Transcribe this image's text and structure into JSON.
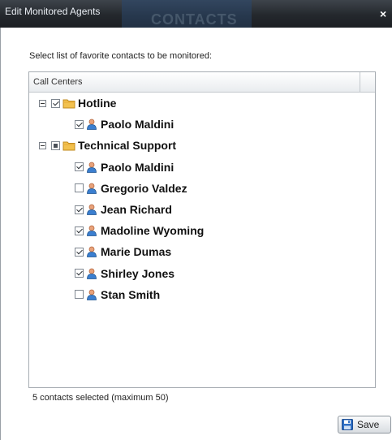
{
  "dialog": {
    "title": "Edit Monitored Agents",
    "background_tab_text": "CONTACTS",
    "close_label": "×",
    "instruction": "Select list of favorite contacts to be monitored:",
    "column_header": "Call Centers",
    "status": "5 contacts selected (maximum 50)",
    "save_label": "Save"
  },
  "tree": {
    "groups": [
      {
        "label": "Hotline",
        "state": "checked",
        "icon": "folder-icon",
        "members": [
          {
            "label": "Paolo Maldini",
            "checked": true,
            "icon": "person-icon"
          }
        ]
      },
      {
        "label": "Technical Support",
        "state": "partial",
        "icon": "folder-icon",
        "members": [
          {
            "label": "Paolo Maldini",
            "checked": true,
            "icon": "person-icon"
          },
          {
            "label": "Gregorio Valdez",
            "checked": false,
            "icon": "person-icon"
          },
          {
            "label": "Jean Richard",
            "checked": true,
            "icon": "person-icon"
          },
          {
            "label": "Madoline Wyoming",
            "checked": true,
            "icon": "person-icon"
          },
          {
            "label": "Marie Dumas",
            "checked": true,
            "icon": "person-icon"
          },
          {
            "label": "Shirley Jones",
            "checked": true,
            "icon": "person-icon"
          },
          {
            "label": "Stan Smith",
            "checked": false,
            "icon": "person-icon"
          }
        ]
      }
    ]
  },
  "colors": {
    "titlebar": "#24282d",
    "folder": "#f2c14e",
    "person_head": "#e8a27a",
    "person_body": "#3b7fd0",
    "save_icon": "#2f6fc4"
  }
}
